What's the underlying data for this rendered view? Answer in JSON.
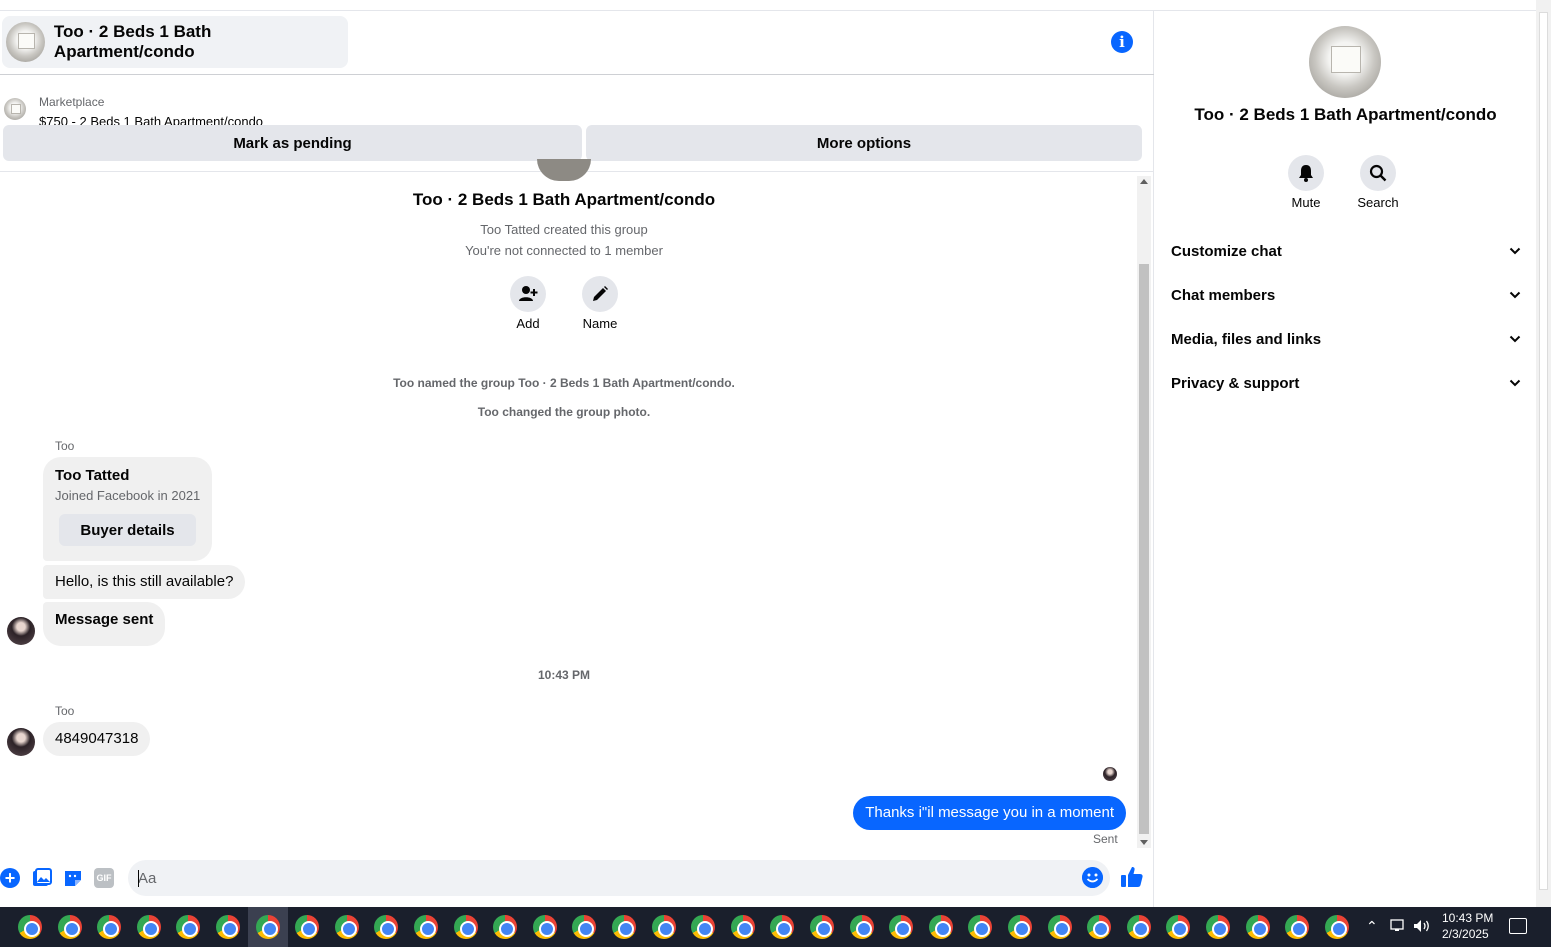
{
  "header": {
    "title": "Too · 2 Beds 1 Bath Apartment/condo"
  },
  "marketplace": {
    "label": "Marketplace",
    "item": "$750 - 2 Beds 1 Bath Apartment/condo"
  },
  "actions": {
    "mark_pending": "Mark as pending",
    "more_options": "More options"
  },
  "group_intro": {
    "title": "Too · 2 Beds 1 Bath Apartment/condo",
    "created": "Too Tatted created this group",
    "connection": "You're not connected to 1 member",
    "add_label": "Add",
    "name_label": "Name"
  },
  "system_messages": [
    "Too named the group Too · 2 Beds 1 Bath Apartment/condo.",
    "Too changed the group photo."
  ],
  "messages": {
    "sender1": "Too",
    "card_name": "Too Tatted",
    "card_sub": "Joined Facebook in 2021",
    "card_button": "Buyer details",
    "hello": "Hello, is this still available?",
    "message_sent": "Message sent",
    "timestamp": "10:43 PM",
    "sender2": "Too",
    "phone": "4849047318",
    "outgoing": "Thanks i\"il message you in a moment",
    "status": "Sent"
  },
  "composer": {
    "placeholder": "Aa",
    "gif_label": "GIF"
  },
  "right_panel": {
    "title": "Too · 2 Beds 1 Bath Apartment/condo",
    "mute_label": "Mute",
    "search_label": "Search",
    "sections": [
      "Customize chat",
      "Chat members",
      "Media, files and links",
      "Privacy & support"
    ]
  },
  "taskbar": {
    "time": "10:43 PM",
    "date": "2/3/2025",
    "app_count": 34
  },
  "colors": {
    "accent": "#0866ff",
    "bubble_grey": "#f0f0f0",
    "taskbar": "#1a1f2c"
  }
}
